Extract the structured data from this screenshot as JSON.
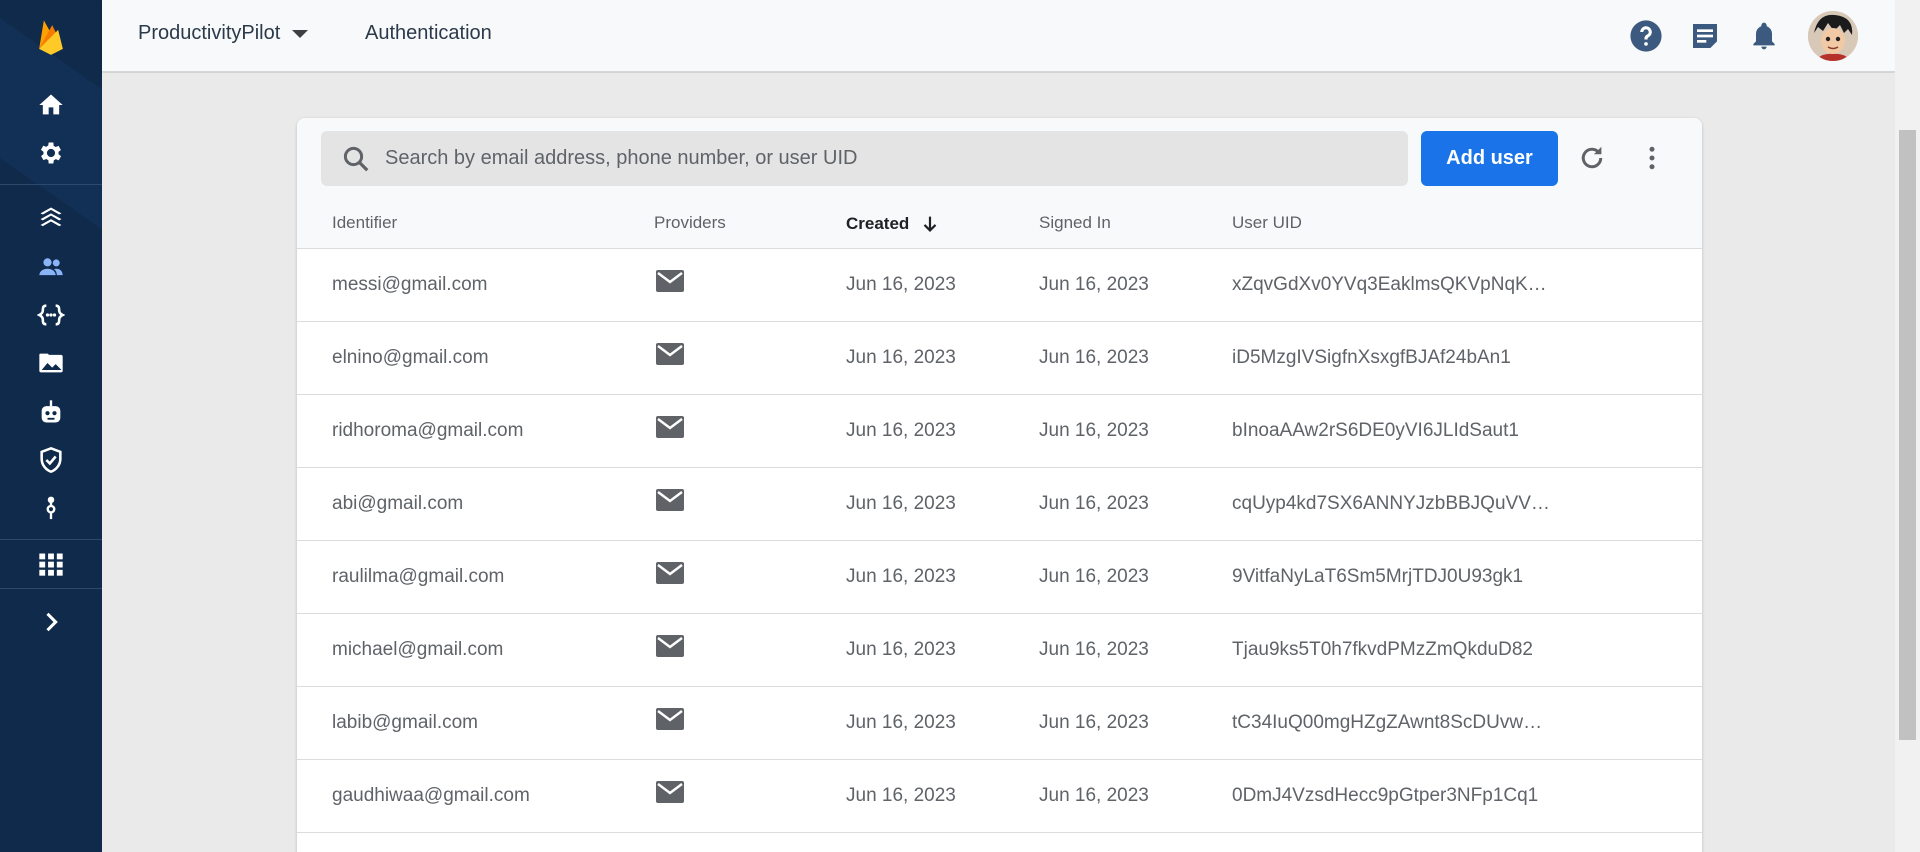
{
  "topbar": {
    "project_name": "ProductivityPilot",
    "section_title": "Authentication",
    "icons": [
      "help-icon",
      "feedback-icon",
      "notifications-icon"
    ]
  },
  "sidebar": {
    "items": [
      "home",
      "settings",
      "build",
      "authentication",
      "functions",
      "storage",
      "ml-kit",
      "app-check",
      "extensions",
      "all-products",
      "expand"
    ],
    "active": "authentication",
    "colors": {
      "bg": "#0f2a4b",
      "icon": "#ffffff",
      "active_icon": "#8ab4f8"
    }
  },
  "search": {
    "placeholder": "Search by email address, phone number, or user UID",
    "value": ""
  },
  "actions": {
    "add_user_label": "Add user"
  },
  "table": {
    "columns": {
      "identifier": "Identifier",
      "providers": "Providers",
      "created": "Created",
      "signed_in": "Signed In",
      "user_uid": "User UID"
    },
    "sort_column": "created",
    "sort_direction": "descending",
    "rows": [
      {
        "identifier": "messi@gmail.com",
        "provider": "email",
        "created": "Jun 16, 2023",
        "signed_in": "Jun 16, 2023",
        "uid": "xZqvGdXv0YVq3EaklmsQKVpNqK…"
      },
      {
        "identifier": "elnino@gmail.com",
        "provider": "email",
        "created": "Jun 16, 2023",
        "signed_in": "Jun 16, 2023",
        "uid": "iD5MzgIVSigfnXsxgfBJAf24bAn1"
      },
      {
        "identifier": "ridhoroma@gmail.com",
        "provider": "email",
        "created": "Jun 16, 2023",
        "signed_in": "Jun 16, 2023",
        "uid": "bInoaAAw2rS6DE0yVI6JLIdSaut1"
      },
      {
        "identifier": "abi@gmail.com",
        "provider": "email",
        "created": "Jun 16, 2023",
        "signed_in": "Jun 16, 2023",
        "uid": "cqUyp4kd7SX6ANNYJzbBBJQuVV…"
      },
      {
        "identifier": "raulilma@gmail.com",
        "provider": "email",
        "created": "Jun 16, 2023",
        "signed_in": "Jun 16, 2023",
        "uid": "9VitfaNyLaT6Sm5MrjTDJ0U93gk1"
      },
      {
        "identifier": "michael@gmail.com",
        "provider": "email",
        "created": "Jun 16, 2023",
        "signed_in": "Jun 16, 2023",
        "uid": "Tjau9ks5T0h7fkvdPMzZmQkduD82"
      },
      {
        "identifier": "labib@gmail.com",
        "provider": "email",
        "created": "Jun 16, 2023",
        "signed_in": "Jun 16, 2023",
        "uid": "tC34IuQ00mgHZgZAwnt8ScDUvw…"
      },
      {
        "identifier": "gaudhiwaa@gmail.com",
        "provider": "email",
        "created": "Jun 16, 2023",
        "signed_in": "Jun 16, 2023",
        "uid": "0DmJ4VzsdHecc9pGtper3NFp1Cq1"
      }
    ]
  },
  "colors": {
    "accent": "#1a73e8",
    "page_bg": "#eaeaea"
  }
}
